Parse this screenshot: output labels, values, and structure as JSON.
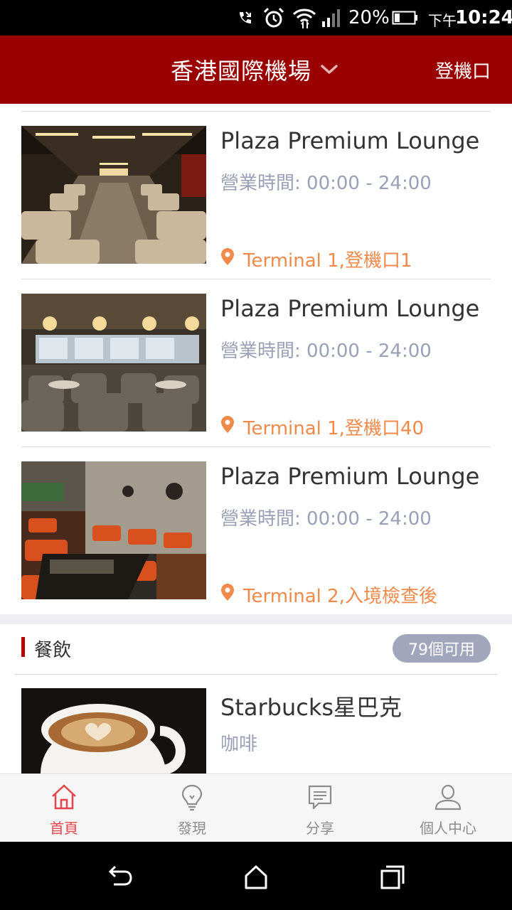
{
  "status_bar": {
    "battery": "20%",
    "ampm": "下午",
    "time": "10:24",
    "icons": [
      "missed-call-icon",
      "alarm-icon",
      "wifi-icon",
      "signal-icon",
      "battery-icon"
    ]
  },
  "header": {
    "title": "香港國際機場",
    "gate_link": "登機口",
    "background": "#9a0000"
  },
  "lounges": [
    {
      "name": "Plaza Premium Lounge",
      "hours": "營業時間: 00:00 - 24:00",
      "location": "Terminal 1,登機口1"
    },
    {
      "name": "Plaza Premium Lounge",
      "hours": "營業時間: 00:00 - 24:00",
      "location": "Terminal 1,登機口40"
    },
    {
      "name": "Plaza Premium Lounge",
      "hours": "營業時間: 00:00 - 24:00",
      "location": "Terminal 2,入境檢查後"
    }
  ],
  "dining_section": {
    "title": "餐飲",
    "badge": "79個可用",
    "items": [
      {
        "name": "Starbucks星巴克",
        "type": "咖啡"
      }
    ]
  },
  "tabs": [
    {
      "label": "首頁",
      "icon": "home-icon",
      "active": true
    },
    {
      "label": "發現",
      "icon": "lightbulb-icon",
      "active": false
    },
    {
      "label": "分享",
      "icon": "message-icon",
      "active": false
    },
    {
      "label": "個人中心",
      "icon": "user-icon",
      "active": false
    }
  ],
  "colors": {
    "accent": "#9a0000",
    "location": "#f08a4b",
    "muted": "#9aa1b6",
    "badge": "#a1a6bd",
    "active_tab": "#e4444b"
  }
}
